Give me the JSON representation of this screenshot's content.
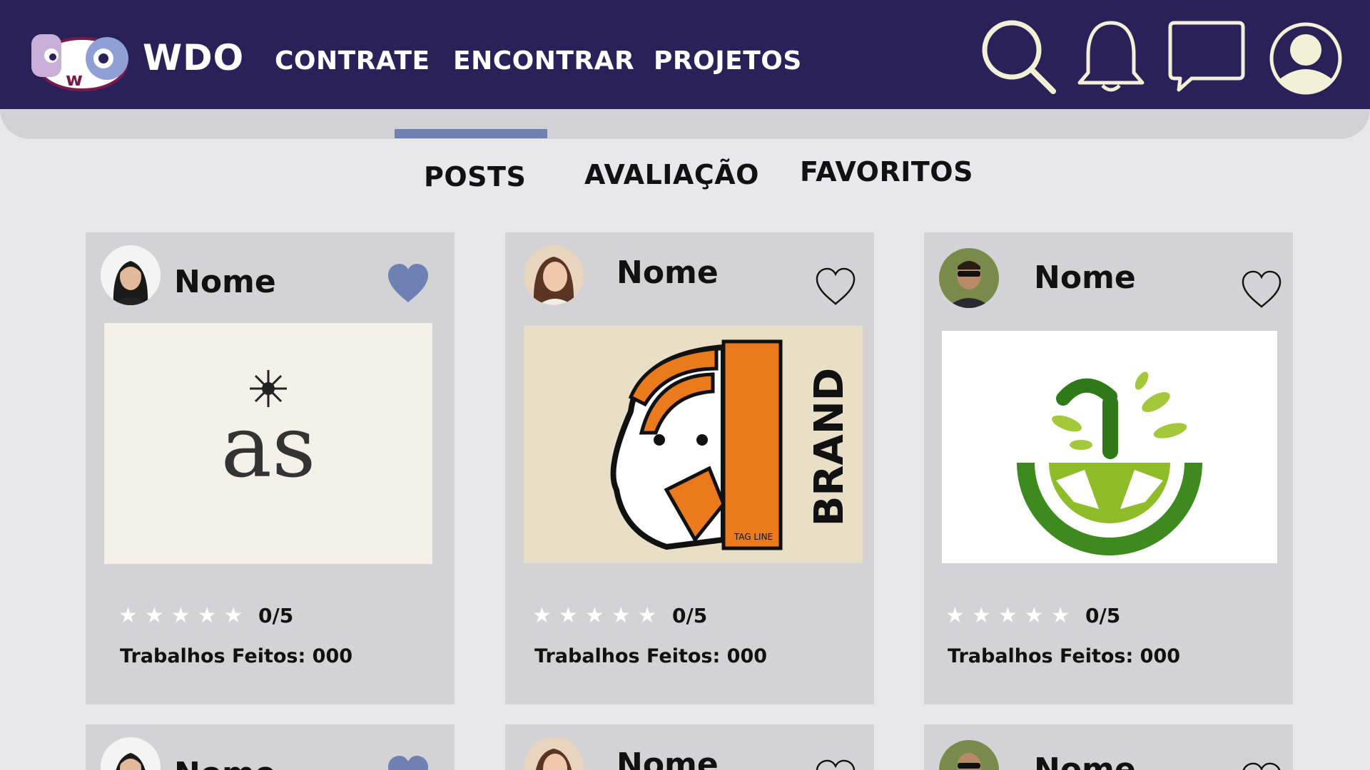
{
  "header": {
    "logo_letters": "Dwo",
    "brand": "WDO",
    "nav": [
      "CONTRATE",
      "ENCONTRAR",
      "PROJETOS"
    ],
    "icons": [
      "search-icon",
      "bell-icon",
      "chat-icon",
      "user-icon"
    ]
  },
  "tabs": {
    "items": [
      "POSTS",
      "AVALIAÇÃO",
      "FAVORITOS"
    ],
    "active": "POSTS"
  },
  "colors": {
    "header_bg": "#2a2159",
    "accent": "#6f80b2",
    "card_bg": "#d3d3d5",
    "page_bg": "#e8e8ec"
  },
  "cards": [
    {
      "name": "Nome",
      "favorited": true,
      "thumb_text": "as",
      "rating": "0/5",
      "works": "Trabalhos Feitos: 000"
    },
    {
      "name": "Nome",
      "favorited": false,
      "thumb_text": "BRAND",
      "thumb_sub": "TAG LINE",
      "rating": "0/5",
      "works": "Trabalhos Feitos: 000"
    },
    {
      "name": "Nome",
      "favorited": false,
      "thumb_text": "",
      "rating": "0/5",
      "works": "Trabalhos Feitos: 000"
    },
    {
      "name": "Nome",
      "favorited": true
    },
    {
      "name": "Nome",
      "favorited": false
    },
    {
      "name": "Nome",
      "favorited": false
    }
  ]
}
